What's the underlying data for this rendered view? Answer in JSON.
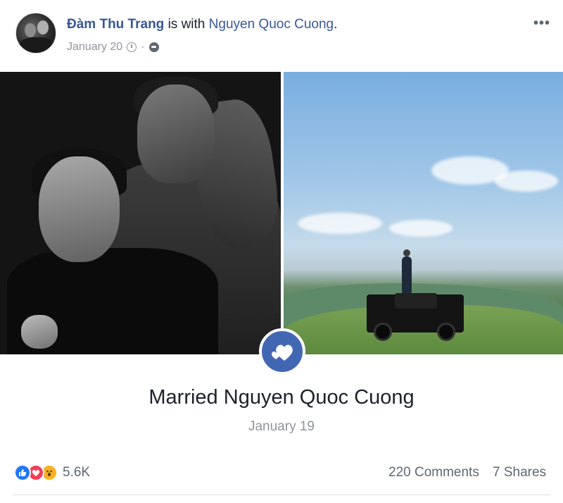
{
  "post": {
    "author": "Đàm Thu Trang",
    "with_text": " is with ",
    "tagged": "Nguyen Quoc Cuong",
    "tagged_suffix": ".",
    "date": "January 20",
    "meta_separator": "·",
    "more_label": "•••"
  },
  "life_event": {
    "title": "Married Nguyen Quoc Cuong",
    "date": "January 19",
    "icon": "hearts-icon",
    "badge_color": "#4267b2"
  },
  "footer": {
    "reactions": [
      "like",
      "love",
      "wow"
    ],
    "reaction_count": "5.6K",
    "comments": "220 Comments",
    "shares": "7 Shares"
  },
  "colors": {
    "link": "#365899",
    "meta": "#90949c",
    "like": "#2078f4",
    "love": "#f33e58",
    "wow": "#f7b125"
  }
}
